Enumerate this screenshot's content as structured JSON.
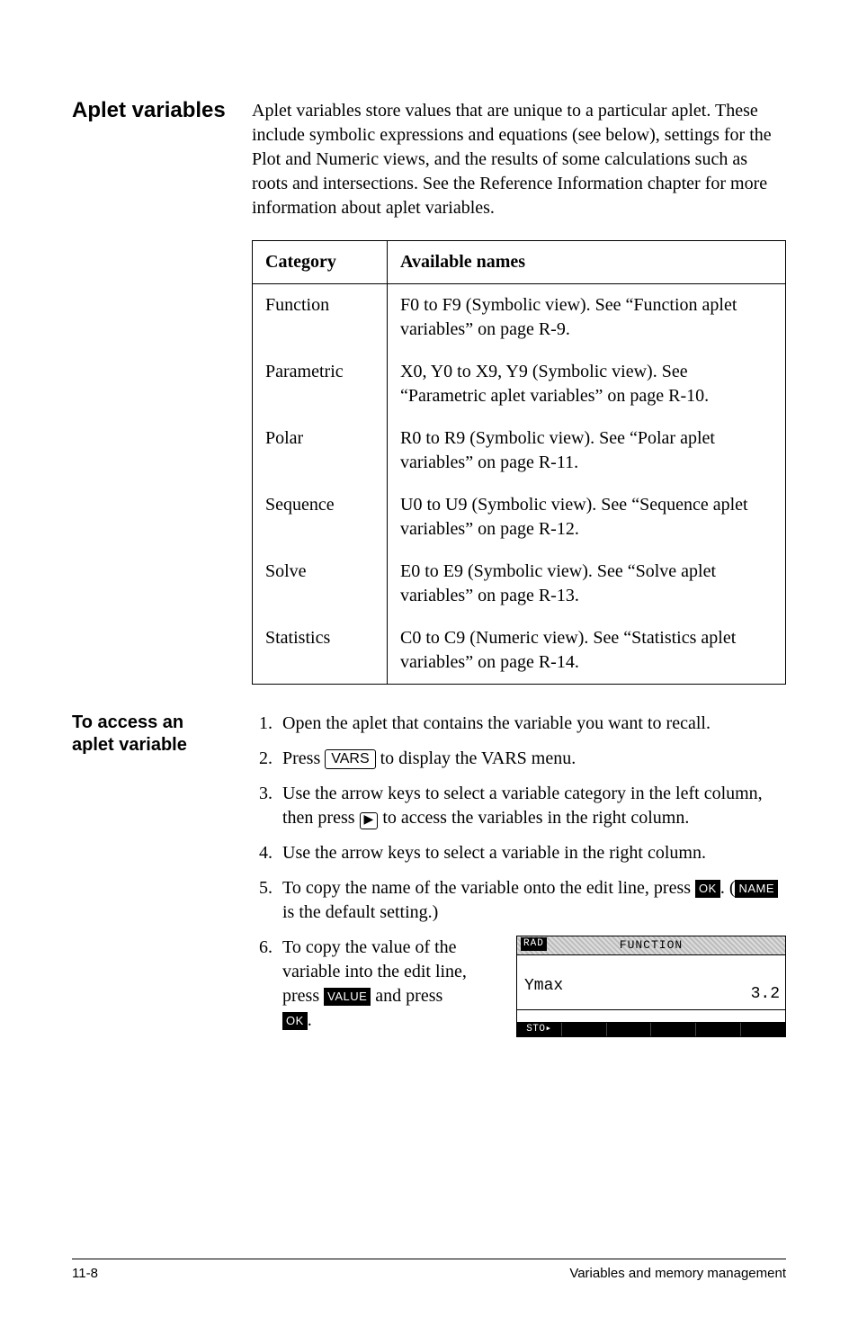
{
  "section1": {
    "title": "Aplet variables",
    "intro": "Aplet variables store values that are unique to a particular aplet. These include symbolic expressions and equations (see below), settings for the Plot and Numeric views, and the results of some calculations such as roots and intersections. See the Reference Information chapter for more information about aplet variables."
  },
  "table": {
    "headers": {
      "c1": "Category",
      "c2": "Available names"
    },
    "rows": [
      {
        "cat": "Function",
        "desc": "F0 to F9 (Symbolic view). See “Function aplet variables” on page R-9."
      },
      {
        "cat": "Parametric",
        "desc": "X0, Y0 to X9, Y9 (Symbolic view). See “Parametric aplet variables” on page R-10."
      },
      {
        "cat": "Polar",
        "desc": "R0 to R9 (Symbolic view). See “Polar aplet variables” on page R-11."
      },
      {
        "cat": "Sequence",
        "desc": "U0 to U9 (Symbolic view). See “Sequence aplet variables” on page R-12."
      },
      {
        "cat": "Solve",
        "desc": "E0 to E9 (Symbolic view). See “Solve aplet variables” on page R-13."
      },
      {
        "cat": "Statistics",
        "desc": "C0 to C9 (Numeric view). See “Statistics aplet variables” on page R-14."
      }
    ]
  },
  "section2": {
    "title_line1": "To access an",
    "title_line2": "aplet variable",
    "steps": {
      "s1": "Open the aplet that contains the variable you want to recall.",
      "s2a": "Press ",
      "s2_key": "VARS",
      "s2b": " to display the VARS menu.",
      "s3a": "Use the arrow keys to select a variable category in the left column, then press ",
      "s3_arrow": "▶",
      "s3b": " to access the variables in the right column.",
      "s4": "Use the arrow keys to select a variable in the right column.",
      "s5a": "To copy the name of the variable onto the edit line, press ",
      "s5_ok": "OK",
      "s5b": ". (",
      "s5_name": "NAME",
      "s5c": " is the default setting.)",
      "s6a": "To copy the value of the variable into the edit line, press ",
      "s6_value": "VALUE",
      "s6b": " and press ",
      "s6_ok": "OK",
      "s6c": "."
    }
  },
  "calcscreen": {
    "rad": "RAD",
    "title": "FUNCTION",
    "ymax": "Ymax",
    "value": "3.2",
    "menu1": "STO▸"
  },
  "footer": {
    "page": "11-8",
    "chapter": "Variables and memory management"
  }
}
